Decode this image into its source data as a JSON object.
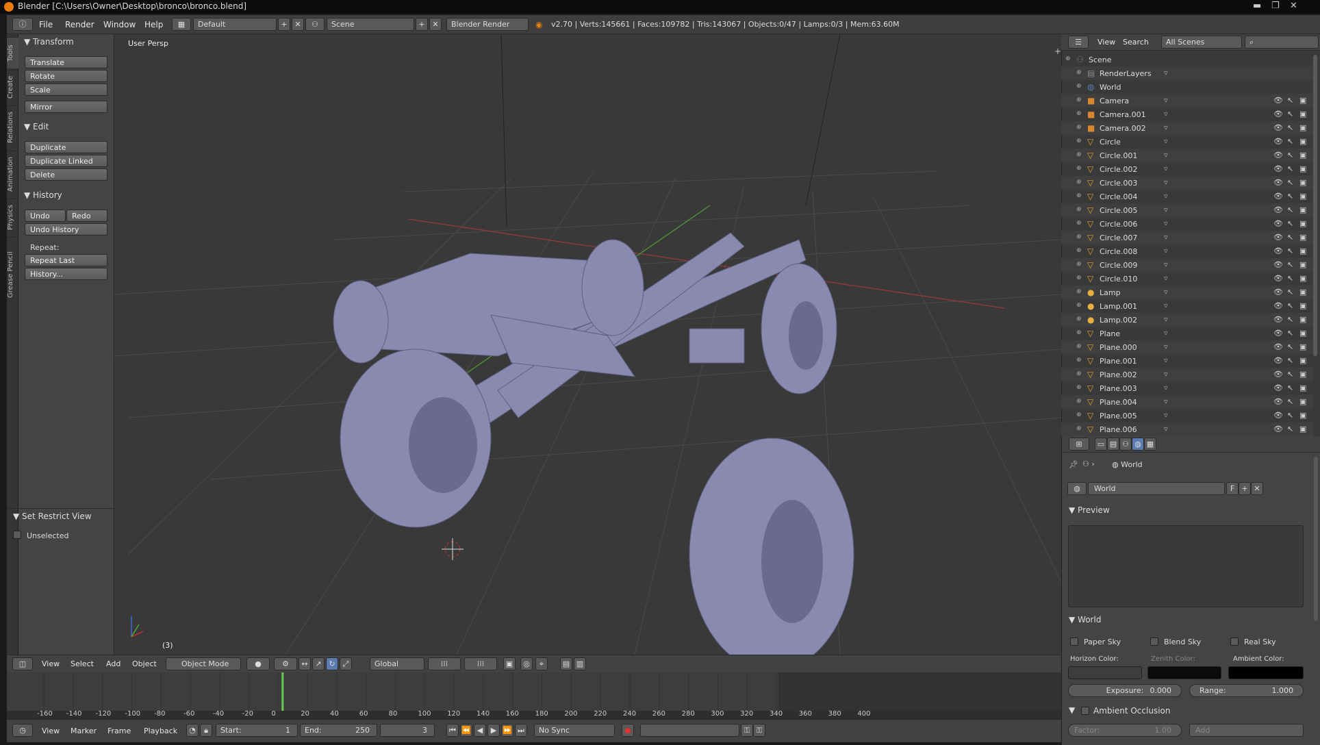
{
  "titlebar": {
    "title": "Blender [C:\\Users\\Owner\\Desktop\\bronco\\bronco.blend]"
  },
  "infobar": {
    "menus": [
      "File",
      "Render",
      "Window",
      "Help"
    ],
    "screen_layout": "Default",
    "scene": "Scene",
    "engine": "Blender Render",
    "stats": "v2.70 | Verts:145661 | Faces:109782 | Tris:143067 | Objects:0/47 | Lamps:0/3 | Mem:63.60M"
  },
  "left_tabs": [
    "Tools",
    "Create",
    "Relations",
    "Animation",
    "Physics",
    "Grease Pencil"
  ],
  "toolshelf": {
    "transform": {
      "header": "Transform",
      "buttons": [
        "Translate",
        "Rotate",
        "Scale",
        "Mirror"
      ]
    },
    "edit": {
      "header": "Edit",
      "buttons": [
        "Duplicate",
        "Duplicate Linked",
        "Delete"
      ]
    },
    "history": {
      "header": "History",
      "undo": "Undo",
      "redo": "Redo",
      "undo_history": "Undo History",
      "repeat_label": "Repeat:",
      "repeat_last": "Repeat Last",
      "history_btn": "History..."
    },
    "restrict": {
      "header": "Set Restrict View",
      "unselected": "Unselected"
    }
  },
  "viewport": {
    "view_label": "User Persp",
    "frame_indicator": "(3)"
  },
  "vpheader": {
    "menus": [
      "View",
      "Select",
      "Add",
      "Object"
    ],
    "mode": "Object Mode",
    "orientation": "Global"
  },
  "timeline": {
    "ticks": [
      "-160",
      "-140",
      "-120",
      "-100",
      "-80",
      "-60",
      "-40",
      "-20",
      "0",
      "20",
      "40",
      "60",
      "80",
      "100",
      "120",
      "140",
      "160",
      "180",
      "200",
      "220",
      "240",
      "260",
      "280",
      "300",
      "320",
      "340",
      "360",
      "380",
      "400"
    ],
    "current_frame": 3,
    "menus": [
      "View",
      "Marker",
      "Frame",
      "Playback"
    ],
    "start_label": "Start:",
    "start": "1",
    "end_label": "End:",
    "end": "250",
    "frame": "3",
    "sync": "No Sync"
  },
  "outliner": {
    "header": {
      "view": "View",
      "search": "Search",
      "filter": "All Scenes"
    },
    "rows": [
      {
        "name": "Scene",
        "type": "scene",
        "indent": 0
      },
      {
        "name": "RenderLayers",
        "type": "render",
        "indent": 1
      },
      {
        "name": "World",
        "type": "world",
        "indent": 1
      },
      {
        "name": "Camera",
        "type": "camera",
        "indent": 1
      },
      {
        "name": "Camera.001",
        "type": "camera",
        "indent": 1
      },
      {
        "name": "Camera.002",
        "type": "camera",
        "indent": 1
      },
      {
        "name": "Circle",
        "type": "mesh",
        "indent": 1
      },
      {
        "name": "Circle.001",
        "type": "mesh",
        "indent": 1
      },
      {
        "name": "Circle.002",
        "type": "mesh",
        "indent": 1
      },
      {
        "name": "Circle.003",
        "type": "mesh",
        "indent": 1
      },
      {
        "name": "Circle.004",
        "type": "mesh",
        "indent": 1
      },
      {
        "name": "Circle.005",
        "type": "mesh",
        "indent": 1
      },
      {
        "name": "Circle.006",
        "type": "mesh",
        "indent": 1
      },
      {
        "name": "Circle.007",
        "type": "mesh",
        "indent": 1
      },
      {
        "name": "Circle.008",
        "type": "mesh",
        "indent": 1
      },
      {
        "name": "Circle.009",
        "type": "mesh",
        "indent": 1
      },
      {
        "name": "Circle.010",
        "type": "mesh",
        "indent": 1
      },
      {
        "name": "Lamp",
        "type": "lamp",
        "indent": 1
      },
      {
        "name": "Lamp.001",
        "type": "lamp",
        "indent": 1
      },
      {
        "name": "Lamp.002",
        "type": "lamp",
        "indent": 1
      },
      {
        "name": "Plane",
        "type": "mesh",
        "indent": 1
      },
      {
        "name": "Plane.000",
        "type": "mesh",
        "indent": 1
      },
      {
        "name": "Plane.001",
        "type": "mesh",
        "indent": 1
      },
      {
        "name": "Plane.002",
        "type": "mesh",
        "indent": 1
      },
      {
        "name": "Plane.003",
        "type": "mesh",
        "indent": 1
      },
      {
        "name": "Plane.004",
        "type": "mesh",
        "indent": 1
      },
      {
        "name": "Plane.005",
        "type": "mesh",
        "indent": 1
      },
      {
        "name": "Plane.006",
        "type": "mesh",
        "indent": 1
      }
    ]
  },
  "properties": {
    "breadcrumb": "World",
    "world_name": "World",
    "fake_user": "F",
    "preview_header": "Preview",
    "world_header": "World",
    "paper_sky": "Paper Sky",
    "blend_sky": "Blend Sky",
    "real_sky": "Real Sky",
    "horizon_color_label": "Horizon Color:",
    "zenith_color_label": "Zenith Color:",
    "ambient_color_label": "Ambient Color:",
    "horizon_color": "#3d3d3d",
    "zenith_color": "#0b0b0b",
    "ambient_color": "#000000",
    "exposure_label": "Exposure:",
    "exposure": "0.000",
    "range_label": "Range:",
    "range": "1.000",
    "ao_header": "Ambient Occlusion",
    "factor_label": "Factor:",
    "factor": "1.00",
    "ao_mode": "Add"
  }
}
